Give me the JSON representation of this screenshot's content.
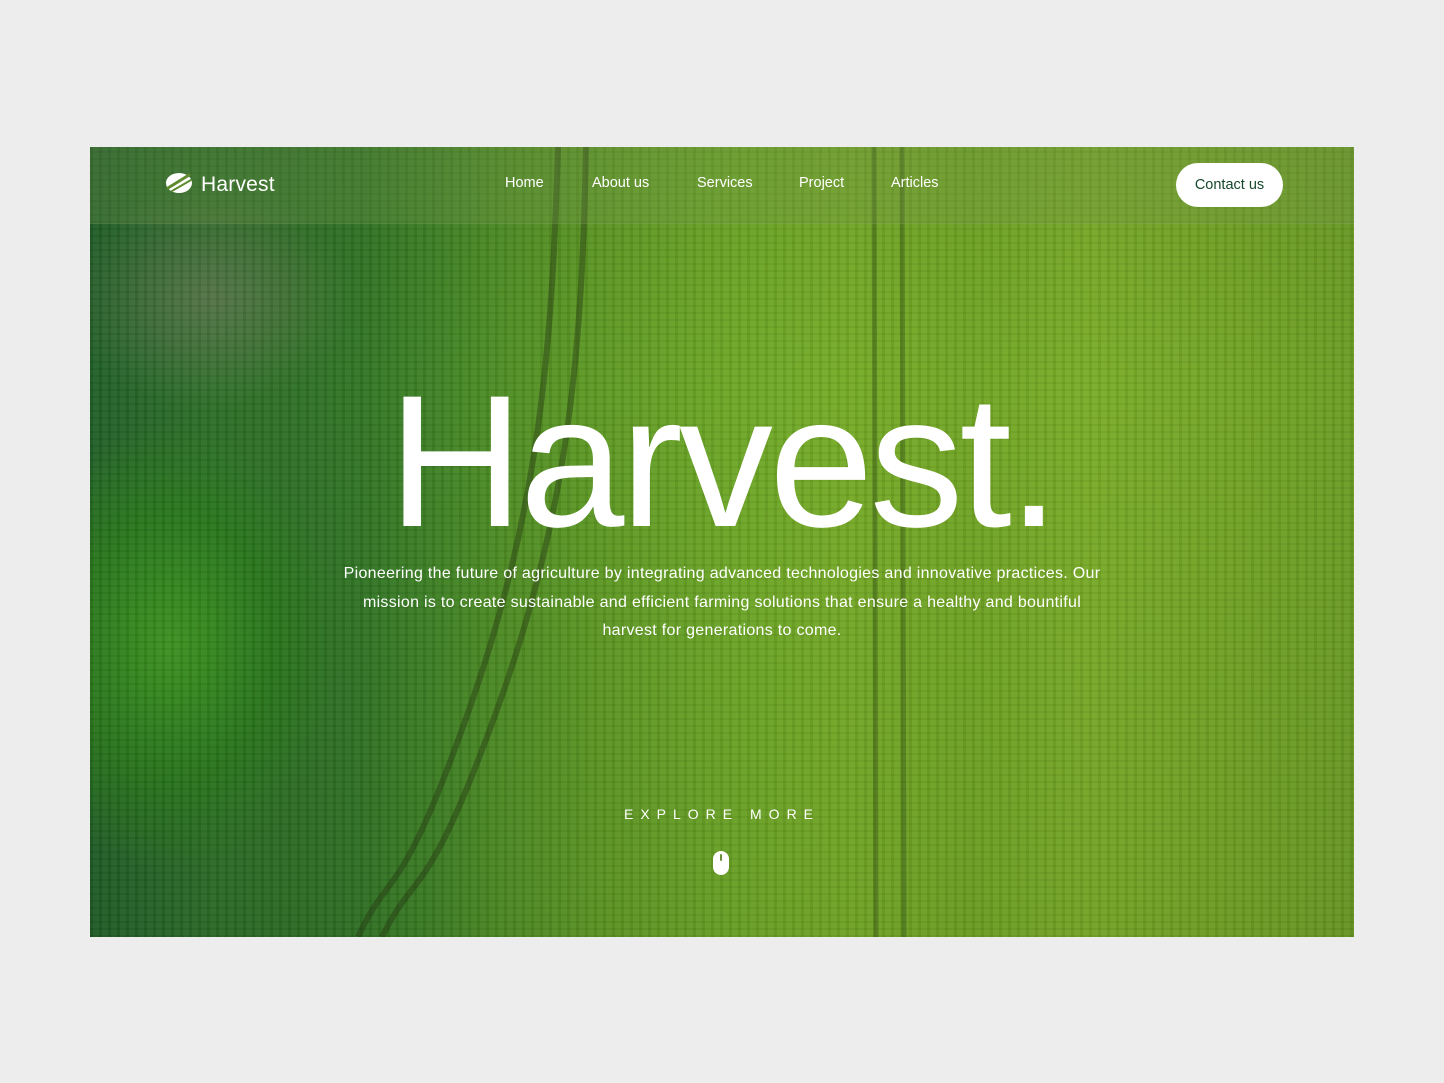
{
  "brand": {
    "name": "Harvest",
    "logo_icon": "leaf-logo-icon"
  },
  "nav": {
    "items": [
      {
        "label": "Home"
      },
      {
        "label": "About us"
      },
      {
        "label": "Services"
      },
      {
        "label": "Project"
      },
      {
        "label": "Articles"
      }
    ],
    "contact_label": "Contact us"
  },
  "hero": {
    "title": "Harvest.",
    "description": "Pioneering the future of agriculture by integrating advanced technologies and innovative practices. Our mission is to create sustainable and efficient farming solutions that ensure a healthy and bountiful harvest for generations to come.",
    "explore_label": "EXPLORE MORE",
    "scroll_icon": "mouse-scroll-icon"
  },
  "colors": {
    "page_background": "#ededed",
    "accent_text": "#15472b",
    "hero_text": "#ffffff",
    "field_green": "#6ba624"
  }
}
